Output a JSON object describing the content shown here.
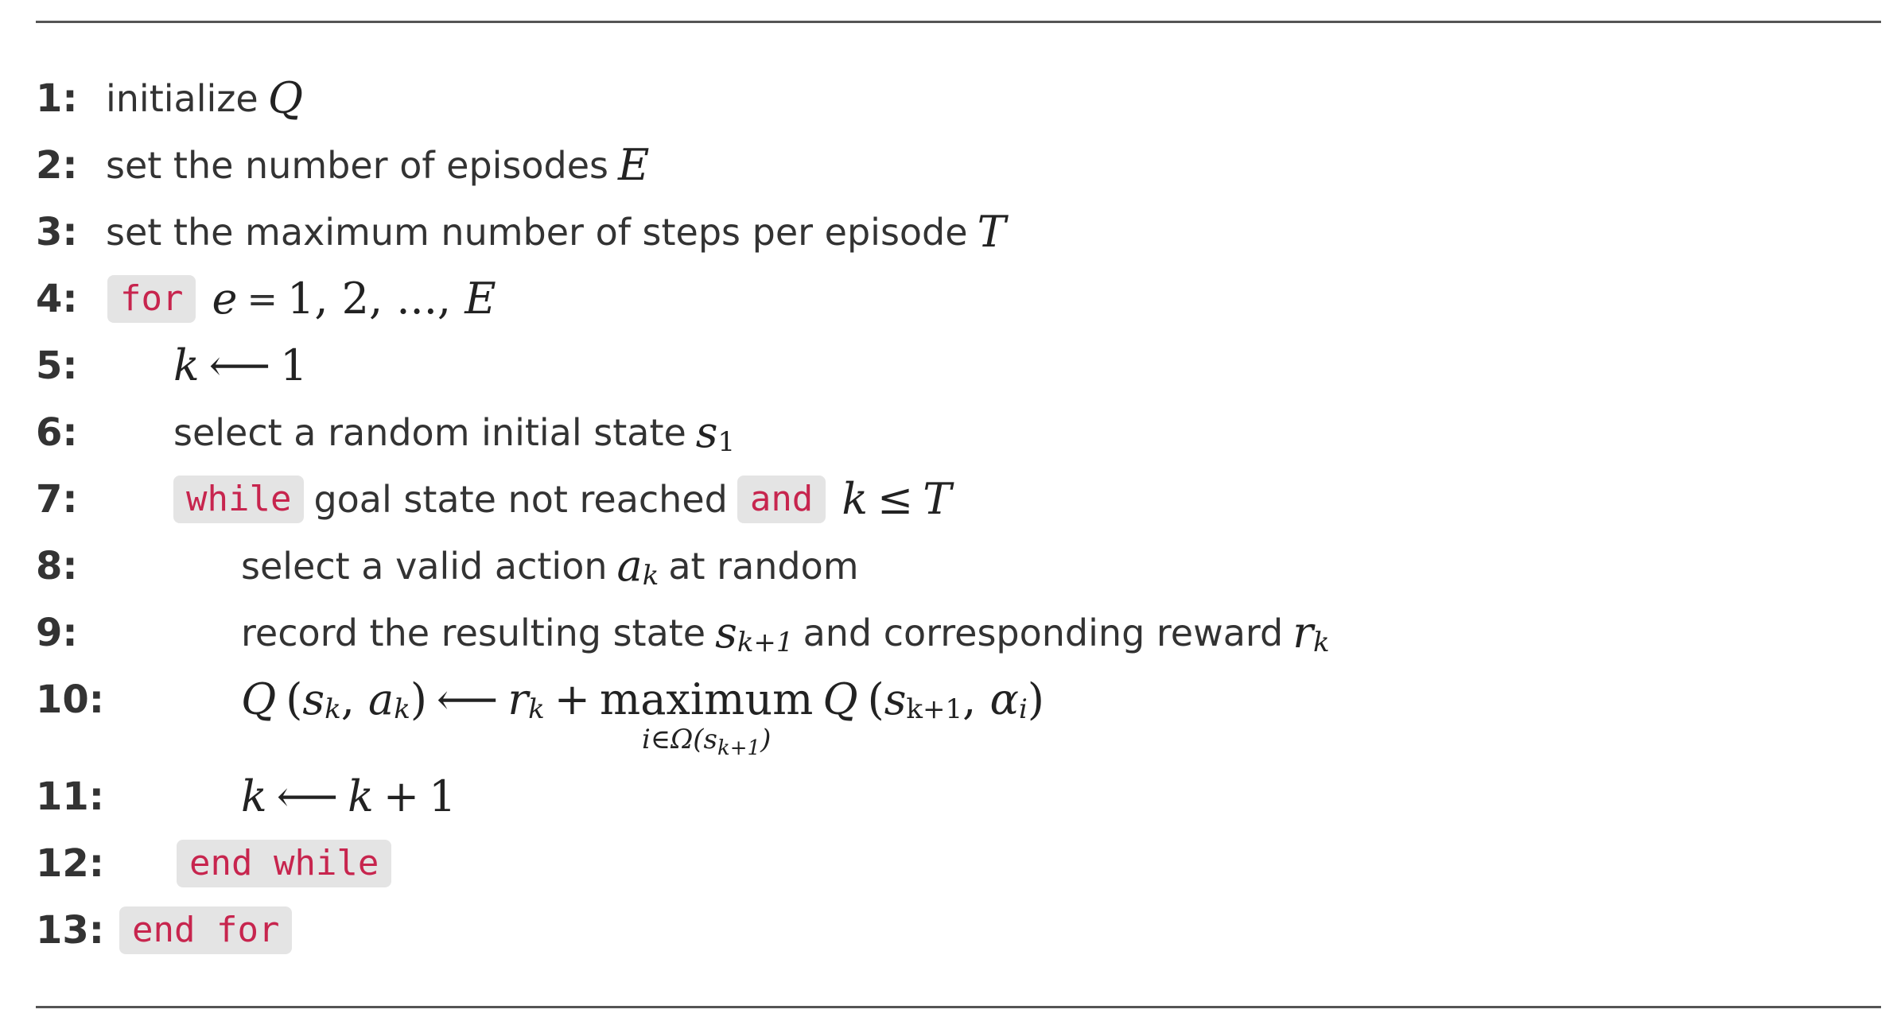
{
  "lines": [
    {
      "num": "1:",
      "text": "initialize",
      "var": "Q"
    },
    {
      "num": "2:",
      "text": "set the number of episodes",
      "var": "E"
    },
    {
      "num": "3:",
      "text": "set the maximum number of steps per episode",
      "var": "T"
    },
    {
      "num": "4:",
      "kw": "for",
      "var": "e",
      "eq": "=",
      "rest": "1, 2, ..., ",
      "end_var": "E"
    },
    {
      "num": "5:",
      "var": "k",
      "arrow": "⟵",
      "val": "1"
    },
    {
      "num": "6:",
      "text": "select a random initial state",
      "var": "s",
      "sub": "1"
    },
    {
      "num": "7:",
      "kw": "while",
      "text": "goal state not reached",
      "kw2": "and",
      "var": "k",
      "op": "≤",
      "var2": "T"
    },
    {
      "num": "8:",
      "text_before": "select a valid action",
      "var": "a",
      "sub": "k",
      "text_after": "at random"
    },
    {
      "num": "9:",
      "text_before": "record the resulting state",
      "var": "s",
      "sub": "k+1",
      "text_mid": "and corresponding reward",
      "var2": "r",
      "sub2": "k"
    },
    {
      "num": "10:",
      "lhs_Q": "Q",
      "lhs_s": "s",
      "lhs_s_sub": "k",
      "lhs_a": "a",
      "lhs_a_sub": "k",
      "arrow": "⟵",
      "r": "r",
      "r_sub": "k",
      "plus": "+",
      "max": "maximum",
      "under": "i∈Ω(s",
      "under_sub": "k+1",
      "under_close": ")",
      "rhs_Q": "Q",
      "rhs_s": "s",
      "rhs_s_sub": "k+1",
      "rhs_alpha": "α",
      "rhs_alpha_sub": "i"
    },
    {
      "num": "11:",
      "var": "k",
      "arrow": "⟵",
      "var2": "k",
      "plus": "+",
      "val": "1"
    },
    {
      "num": "12:",
      "kw": "end while"
    },
    {
      "num": "13:",
      "kw": "end for"
    }
  ]
}
